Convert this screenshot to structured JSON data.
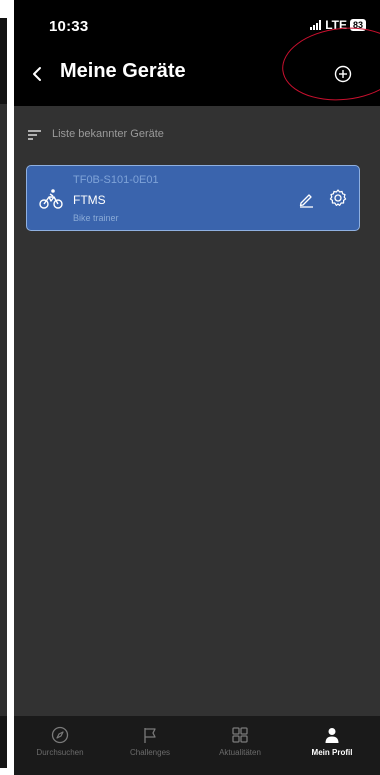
{
  "status_bar": {
    "time": "10:33",
    "network": "LTE",
    "battery": "83"
  },
  "header": {
    "title": "Meine Geräte",
    "back_icon": "chevron-left-icon",
    "add_icon": "plus-circle-icon"
  },
  "section": {
    "label": "Liste bekannter Geräte",
    "icon": "sort-icon"
  },
  "devices": [
    {
      "serial": "TF0B-S101-0E01",
      "name": "FTMS",
      "type": "Bike trainer",
      "icon": "bike-icon",
      "edit_icon": "pencil-icon",
      "settings_icon": "gear-icon"
    }
  ],
  "bottom_nav": {
    "items": [
      {
        "label": "Durchsuchen",
        "icon": "compass-icon",
        "active": false
      },
      {
        "label": "Challenges",
        "icon": "flag-icon",
        "active": false
      },
      {
        "label": "Aktualitäten",
        "icon": "grid-icon",
        "active": false
      },
      {
        "label": "Mein Profil",
        "icon": "person-icon",
        "active": true
      }
    ]
  },
  "colors": {
    "accent_card": "#3a64ad",
    "annotation": "#c8102e",
    "background": "#323232"
  }
}
